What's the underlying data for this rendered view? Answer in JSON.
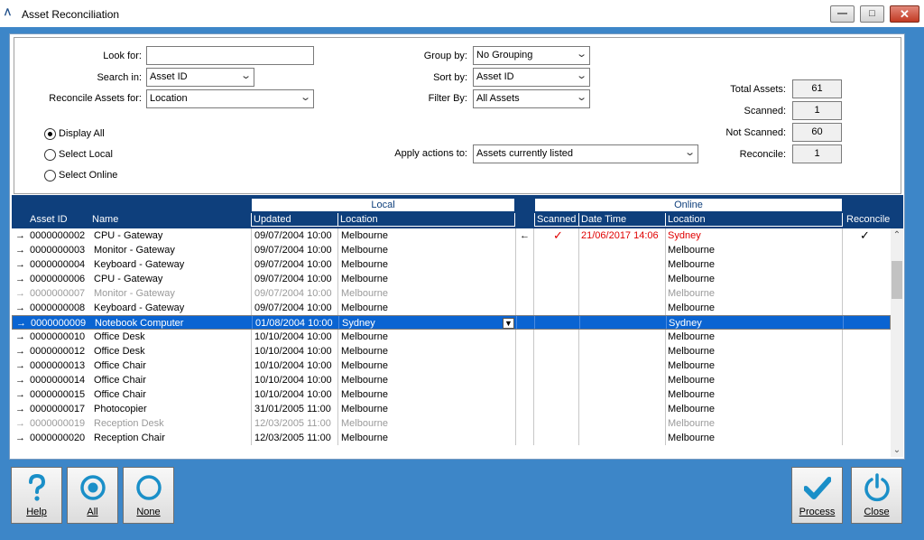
{
  "window": {
    "title": "Asset Reconciliation",
    "controls": {
      "min": "—",
      "max": "□",
      "close": "✕"
    }
  },
  "filters": {
    "look_for_label": "Look for:",
    "look_for_value": "",
    "search_in_label": "Search in:",
    "search_in_value": "Asset ID",
    "reconcile_for_label": "Reconcile Assets for:",
    "reconcile_for_value": "Location",
    "group_by_label": "Group by:",
    "group_by_value": "No Grouping",
    "sort_by_label": "Sort by:",
    "sort_by_value": "Asset ID",
    "filter_by_label": "Filter By:",
    "filter_by_value": "All Assets",
    "apply_actions_label": "Apply actions to:",
    "apply_actions_value": "Assets currently listed"
  },
  "radios": {
    "display_all": "Display All",
    "select_local": "Select Local",
    "select_online": "Select Online",
    "selected": "display_all"
  },
  "totals": {
    "total_label": "Total Assets:",
    "total_value": "61",
    "scanned_label": "Scanned:",
    "scanned_value": "1",
    "not_scanned_label": "Not Scanned:",
    "not_scanned_value": "60",
    "reconcile_label": "Reconcile:",
    "reconcile_value": "1"
  },
  "grid": {
    "group_local": "Local",
    "group_online": "Online",
    "headers": {
      "asset_id": "Asset ID",
      "name": "Name",
      "updated": "Updated",
      "location": "Location",
      "scanned": "Scanned",
      "date_time": "Date Time",
      "online_location": "Location",
      "reconcile": "Reconcile"
    },
    "rows": [
      {
        "id": "0000000002",
        "name": "CPU - Gateway",
        "updated": "09/07/2004 10:00",
        "location": "Melbourne",
        "direction": "←",
        "scanned": "✓",
        "date_time": "21/06/2017 14:06",
        "online_location": "Sydney",
        "reconcile": "✓",
        "state": "normal",
        "highlight_online": true
      },
      {
        "id": "0000000003",
        "name": "Monitor - Gateway",
        "updated": "09/07/2004 10:00",
        "location": "Melbourne",
        "direction": "",
        "scanned": "",
        "date_time": "",
        "online_location": "Melbourne",
        "reconcile": "",
        "state": "normal"
      },
      {
        "id": "0000000004",
        "name": "Keyboard - Gateway",
        "updated": "09/07/2004 10:00",
        "location": "Melbourne",
        "direction": "",
        "scanned": "",
        "date_time": "",
        "online_location": "Melbourne",
        "reconcile": "",
        "state": "normal"
      },
      {
        "id": "0000000006",
        "name": "CPU - Gateway",
        "updated": "09/07/2004 10:00",
        "location": "Melbourne",
        "direction": "",
        "scanned": "",
        "date_time": "",
        "online_location": "Melbourne",
        "reconcile": "",
        "state": "normal"
      },
      {
        "id": "0000000007",
        "name": "Monitor - Gateway",
        "updated": "09/07/2004 10:00",
        "location": "Melbourne",
        "direction": "",
        "scanned": "",
        "date_time": "",
        "online_location": "Melbourne",
        "reconcile": "",
        "state": "dim"
      },
      {
        "id": "0000000008",
        "name": "Keyboard - Gateway",
        "updated": "09/07/2004 10:00",
        "location": "Melbourne",
        "direction": "",
        "scanned": "",
        "date_time": "",
        "online_location": "Melbourne",
        "reconcile": "",
        "state": "normal"
      },
      {
        "id": "0000000009",
        "name": "Notebook Computer",
        "updated": "01/08/2004 10:00",
        "location": "Sydney",
        "direction": "",
        "scanned": "",
        "date_time": "",
        "online_location": "Sydney",
        "reconcile": "",
        "state": "selected"
      },
      {
        "id": "0000000010",
        "name": "Office Desk",
        "updated": "10/10/2004 10:00",
        "location": "Melbourne",
        "direction": "",
        "scanned": "",
        "date_time": "",
        "online_location": "Melbourne",
        "reconcile": "",
        "state": "normal"
      },
      {
        "id": "0000000012",
        "name": "Office Desk",
        "updated": "10/10/2004 10:00",
        "location": "Melbourne",
        "direction": "",
        "scanned": "",
        "date_time": "",
        "online_location": "Melbourne",
        "reconcile": "",
        "state": "normal"
      },
      {
        "id": "0000000013",
        "name": "Office Chair",
        "updated": "10/10/2004 10:00",
        "location": "Melbourne",
        "direction": "",
        "scanned": "",
        "date_time": "",
        "online_location": "Melbourne",
        "reconcile": "",
        "state": "normal"
      },
      {
        "id": "0000000014",
        "name": "Office Chair",
        "updated": "10/10/2004 10:00",
        "location": "Melbourne",
        "direction": "",
        "scanned": "",
        "date_time": "",
        "online_location": "Melbourne",
        "reconcile": "",
        "state": "normal"
      },
      {
        "id": "0000000015",
        "name": "Office Chair",
        "updated": "10/10/2004 10:00",
        "location": "Melbourne",
        "direction": "",
        "scanned": "",
        "date_time": "",
        "online_location": "Melbourne",
        "reconcile": "",
        "state": "normal"
      },
      {
        "id": "0000000017",
        "name": "Photocopier",
        "updated": "31/01/2005 11:00",
        "location": "Melbourne",
        "direction": "",
        "scanned": "",
        "date_time": "",
        "online_location": "Melbourne",
        "reconcile": "",
        "state": "normal"
      },
      {
        "id": "0000000019",
        "name": "Reception Desk",
        "updated": "12/03/2005 11:00",
        "location": "Melbourne",
        "direction": "",
        "scanned": "",
        "date_time": "",
        "online_location": "Melbourne",
        "reconcile": "",
        "state": "dim"
      },
      {
        "id": "0000000020",
        "name": "Reception Chair",
        "updated": "12/03/2005 11:00",
        "location": "Melbourne",
        "direction": "",
        "scanned": "",
        "date_time": "",
        "online_location": "Melbourne",
        "reconcile": "",
        "state": "normal"
      }
    ]
  },
  "buttons": {
    "help": "Help",
    "all": "All",
    "none": "None",
    "process": "Process",
    "close": "Close"
  },
  "colors": {
    "accent": "#1a8fc8",
    "header": "#0e3f7c",
    "selection": "#0a64d2",
    "background": "#3d86c8"
  }
}
